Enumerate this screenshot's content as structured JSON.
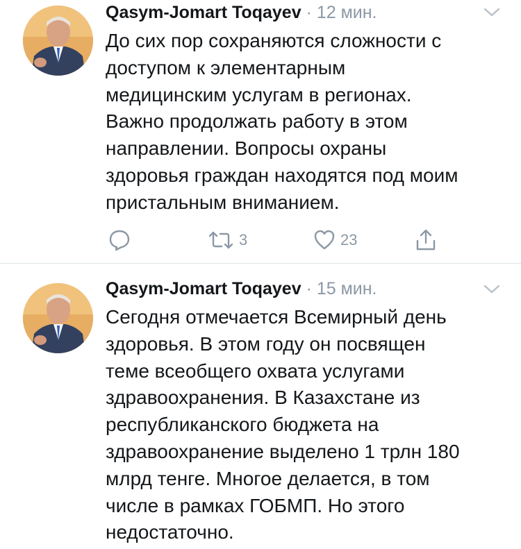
{
  "tweets": [
    {
      "author": "Qasym-Jomart Toqayev",
      "separator": "·",
      "time": "12 мин.",
      "text": "До сих пор сохраняются сложности с\nдоступом к элементарным\nмедицинским услугам в регионах.\nВажно продолжать работу в этом\nнаправлении. Вопросы охраны\nздоровья граждан находятся под моим\nпристальным вниманием.",
      "actions": {
        "reply_icon": "reply-icon",
        "retweet_count": "3",
        "like_count": "23",
        "share_icon": "share-icon"
      }
    },
    {
      "author": "Qasym-Jomart Toqayev",
      "separator": "·",
      "time": "15 мин.",
      "text": "Сегодня отмечается Всемирный день\nздоровья. В этом году он посвящен\nтеме всеобщего охвата услугами\nздравоохранения. В Казахстане из\nреспубликанского бюджета на\nздравоохранение выделено 1 трлн 180\nмлрд тенге. Многое делается, в том\nчисле в рамках ГОБМП. Но этого\nнедостаточно."
    }
  ],
  "colors": {
    "text": "#14171a",
    "meta": "#8b98a5",
    "divider": "#dfe4e8"
  }
}
